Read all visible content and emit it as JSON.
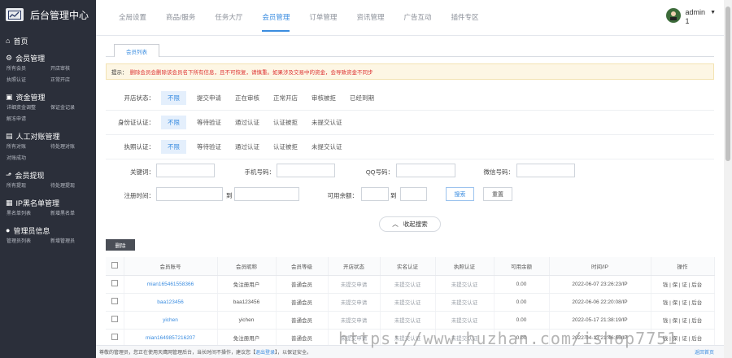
{
  "app": {
    "title": "后台管理中心"
  },
  "sidebar": {
    "home": "首页",
    "groups": [
      {
        "title": "会员管理",
        "items": [
          "所有会员",
          "开店审核",
          "执照认证",
          "正常开店"
        ]
      },
      {
        "title": "资金管理",
        "items": [
          "详细资金调整",
          "保证金记录",
          "解冻申请"
        ]
      },
      {
        "title": "人工对账管理",
        "items": [
          "所有对账",
          "待处理对账",
          "对账成功"
        ]
      },
      {
        "title": "会员提现",
        "items": [
          "所有提现",
          "待处理提现"
        ]
      },
      {
        "title": "IP黑名单管理",
        "items": [
          "黑名单列表",
          "新增黑名单"
        ]
      },
      {
        "title": "管理员信息",
        "items": [
          "管理员列表",
          "新增管理员"
        ]
      }
    ]
  },
  "topnav": {
    "tabs": [
      "全局设置",
      "商品/服务",
      "任务大厅",
      "会员管理",
      "订单管理",
      "资讯管理",
      "广告互动",
      "插件专区"
    ],
    "active_index": 3
  },
  "user": {
    "name": "admin",
    "id": "1"
  },
  "subtab": "会员列表",
  "notice": {
    "label": "提示：",
    "text": "删除会员会删除该会员名下所有信息，且不可恢复，请慎重。如果涉及交易中的资金，会导致资金不同步"
  },
  "filters": {
    "shop_status": {
      "label": "开店状态：",
      "options": [
        "不限",
        "提交申请",
        "正在审核",
        "正常开店",
        "审核被拒",
        "已经到期"
      ]
    },
    "id_verify": {
      "label": "身份证认证：",
      "options": [
        "不限",
        "等待验证",
        "通过认证",
        "认证被拒",
        "未提交认证"
      ]
    },
    "license": {
      "label": "执照认证：",
      "options": [
        "不限",
        "等待验证",
        "通过认证",
        "认证被拒",
        "未提交认证"
      ]
    },
    "keyword": "关键词：",
    "phone": "手机号码：",
    "qq": "QQ号码：",
    "wechat": "微信号码：",
    "reg_time": "注册时间：",
    "to": "到",
    "balance": "可用余额：",
    "search_btn": "搜索",
    "reset_btn": "重置"
  },
  "collapse": "收起搜索",
  "delete_btn": "删除",
  "table": {
    "headers": [
      "会员账号",
      "会员昵称",
      "会员等级",
      "开店状态",
      "实名认证",
      "执照认证",
      "可用余额",
      "时间/IP",
      "操作"
    ],
    "rows": [
      {
        "account": "mian165461558366",
        "nick": "免注册用户",
        "level": "普通会员",
        "shop": "未提交申请",
        "real": "未提交认证",
        "lic": "未提交认证",
        "balance": "0.00",
        "time": "2022-06-07 23:26:23/IP",
        "ops": "钱 | 保 | 证 | 后台"
      },
      {
        "account": "baa123456",
        "nick": "baa123456",
        "level": "普通会员",
        "shop": "未提交申请",
        "real": "未提交认证",
        "lic": "未提交认证",
        "balance": "0.00",
        "time": "2022-06-06 22:20:08/IP",
        "ops": "钱 | 保 | 证 | 后台"
      },
      {
        "account": "yichen",
        "nick": "yichen",
        "level": "普通会员",
        "shop": "未提交申请",
        "real": "未提交认证",
        "lic": "未提交认证",
        "balance": "0.00",
        "time": "2022-05-17 21:38:19/IP",
        "ops": "钱 | 保 | 证 | 后台"
      },
      {
        "account": "mian1649857216207",
        "nick": "免注册用户",
        "level": "普通会员",
        "shop": "未提交申请",
        "real": "未提交认证",
        "lic": "未提交认证",
        "balance": "0.00",
        "time": "2022-04-13 21:46:56/IP",
        "ops": "钱 | 保 | 证 | 后台"
      }
    ]
  },
  "footer": {
    "text1": "尊敬的管理员，您正在使用天鹰网管理后台，当长时间不操作，建议您【",
    "logout": "退出登录",
    "text2": "】，以保证安全。",
    "home": "返回首页"
  },
  "watermark": "https://www.huzhan.com/ishop7751"
}
